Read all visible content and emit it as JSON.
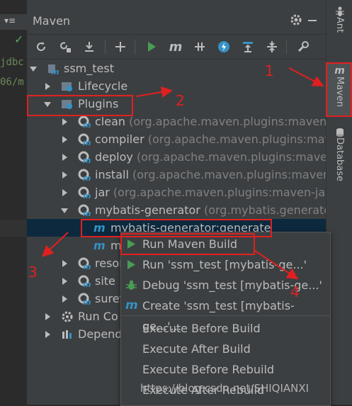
{
  "editor": {
    "lines": [
      "jdbc",
      "06/m"
    ],
    "check": "✓",
    "tab_glyph": "▾≡"
  },
  "panel": {
    "title": "Maven",
    "toolbar": [
      "reload-icon",
      "add-project-icon",
      "download-icon",
      "plus-icon",
      "run-icon",
      "execute-goal-icon",
      "skip-tests-icon",
      "offline-icon",
      "show-deps-icon",
      "collapse-icon",
      "settings-wrench-icon"
    ]
  },
  "tree": {
    "root": "ssm_test",
    "lifecycle": "Lifecycle",
    "plugins": "Plugins",
    "plugin_items": [
      {
        "name": "clean",
        "desc": "(org.apache.maven.plugins:maven-clea"
      },
      {
        "name": "compiler",
        "desc": "(org.apache.maven.plugins:maven-"
      },
      {
        "name": "deploy",
        "desc": "(org.apache.maven.plugins:maven-de"
      },
      {
        "name": "install",
        "desc": "(org.apache.maven.plugins:maven-ins"
      },
      {
        "name": "jar",
        "desc": "(org.apache.maven.plugins:maven-jar-plu"
      },
      {
        "name": "mybatis-generator",
        "desc": "(org.mybatis.generator:m"
      }
    ],
    "goal_selected": "mybatis-generator:generate",
    "goal_partial": "m",
    "partial_items": [
      "resor",
      "site",
      "suref"
    ],
    "partial_suffix": "in",
    "run_configs": "Run Co",
    "dependencies": "Depend"
  },
  "right_tabs": {
    "ant": "Ant",
    "maven": "Maven",
    "database": "Database"
  },
  "context_menu": {
    "items": [
      {
        "label": "Run Maven Build",
        "icon": "run-icon"
      },
      {
        "label": "Run 'ssm_test [mybatis-ge...'",
        "icon": "run-icon"
      },
      {
        "label": "Debug 'ssm_test [mybatis-ge...'",
        "icon": "debug-icon"
      },
      {
        "label": "Create 'ssm_test [mybatis-ge...'...",
        "icon": "maven-m-icon"
      },
      {
        "label": "Execute Before Build",
        "icon": ""
      },
      {
        "label": "Execute After Build",
        "icon": ""
      },
      {
        "label": "Execute Before Rebuild",
        "icon": ""
      },
      {
        "label": "Execute After Rebuild",
        "icon": ""
      }
    ]
  },
  "annotations": {
    "n1": "1",
    "n2": "2",
    "n3": "3",
    "n4": "4"
  },
  "watermark": "https://blog.csdn.net/SHIQIANXI",
  "colors": {
    "accent_red": "#e02020",
    "selection": "#0d293e",
    "menu_hover": "#4b6eaf",
    "run_green": "#499c54"
  }
}
